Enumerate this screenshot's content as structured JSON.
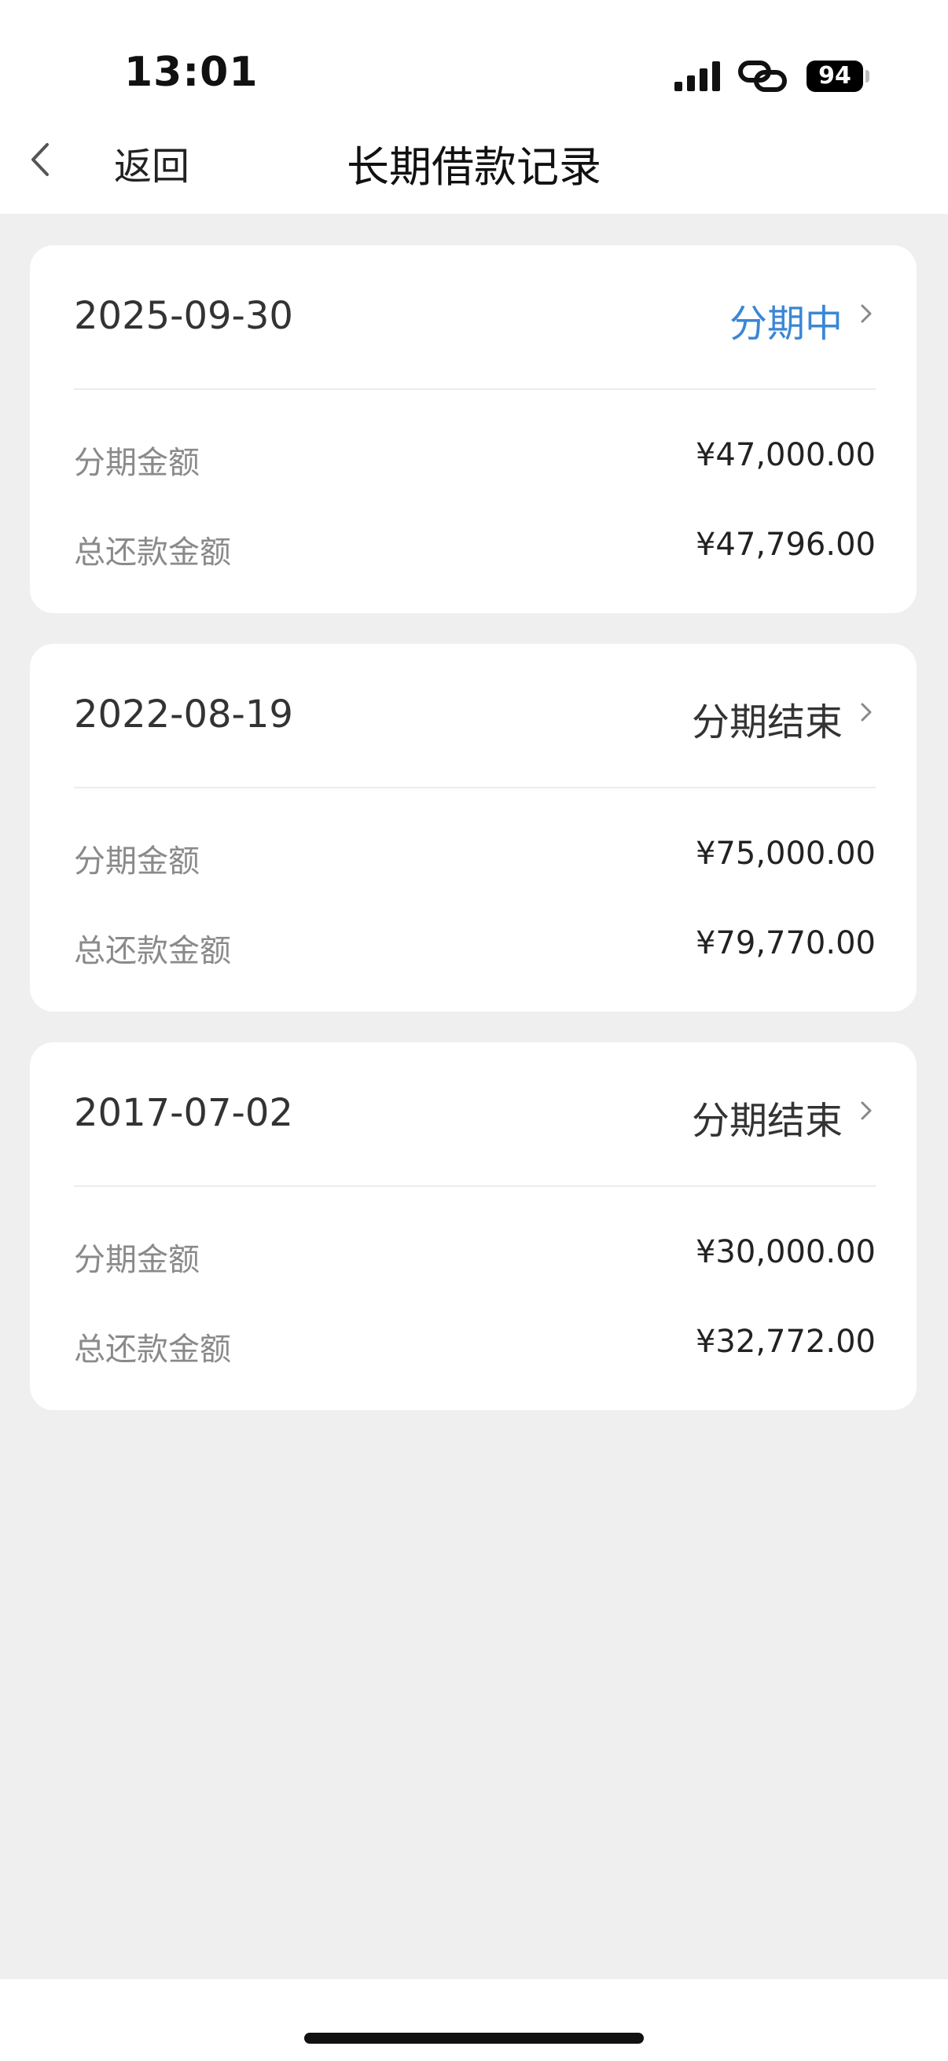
{
  "status_bar": {
    "time": "13:01",
    "battery": "94"
  },
  "nav": {
    "back_label": "返回",
    "title": "长期借款记录"
  },
  "records": [
    {
      "date": "2025-09-30",
      "status": "分期中",
      "active": true,
      "installment_label": "分期金额",
      "installment_amount": "¥47,000.00",
      "total_label": "总还款金额",
      "total_amount": "¥47,796.00"
    },
    {
      "date": "2022-08-19",
      "status": "分期结束",
      "active": false,
      "installment_label": "分期金额",
      "installment_amount": "¥75,000.00",
      "total_label": "总还款金额",
      "total_amount": "¥79,770.00"
    },
    {
      "date": "2017-07-02",
      "status": "分期结束",
      "active": false,
      "installment_label": "分期金额",
      "installment_amount": "¥30,000.00",
      "total_label": "总还款金额",
      "total_amount": "¥32,772.00"
    }
  ],
  "colors": {
    "active_status": "#3b86d6",
    "background": "#efefef"
  }
}
